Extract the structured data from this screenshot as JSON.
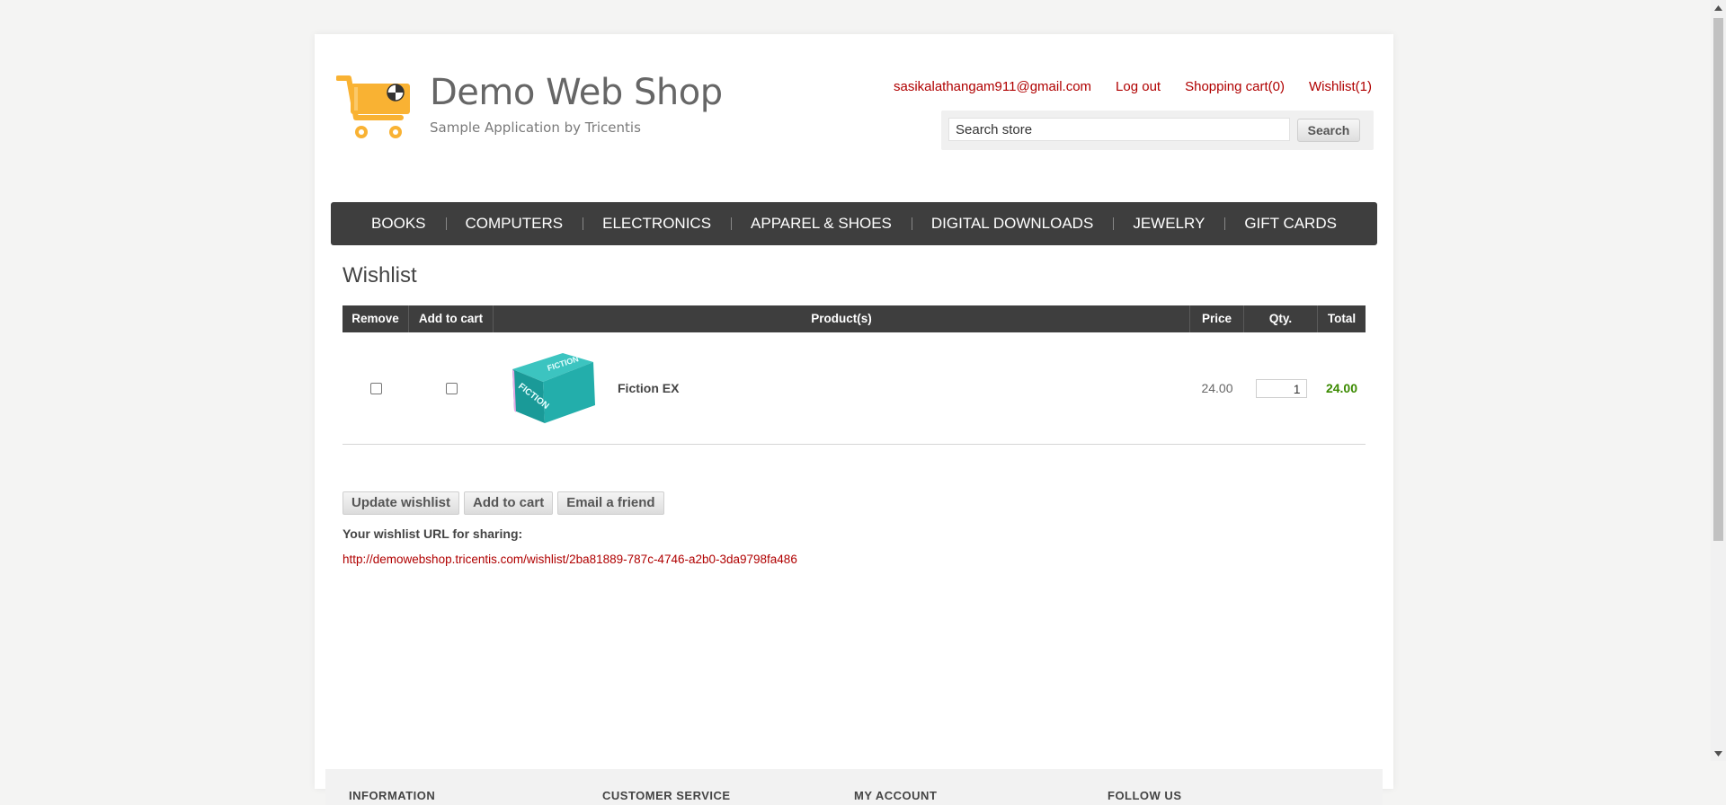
{
  "header": {
    "logo_title": "Demo Web Shop",
    "logo_subtitle": "Sample Application by Tricentis",
    "links": {
      "account": "sasikalathangam911@gmail.com",
      "logout": "Log out",
      "cart": "Shopping cart(0)",
      "wishlist": "Wishlist(1)"
    },
    "search": {
      "value": "Search store",
      "button": "Search"
    }
  },
  "nav": {
    "items": [
      "BOOKS",
      "COMPUTERS",
      "ELECTRONICS",
      "APPAREL & SHOES",
      "DIGITAL DOWNLOADS",
      "JEWELRY",
      "GIFT CARDS"
    ]
  },
  "main": {
    "title": "Wishlist",
    "table": {
      "headers": [
        "Remove",
        "Add to cart",
        "Product(s)",
        "Price",
        "Qty.",
        "Total"
      ],
      "rows": [
        {
          "product": "Fiction EX",
          "image_text": "FICTION",
          "price": "24.00",
          "qty": "1",
          "total": "24.00"
        }
      ]
    },
    "buttons": {
      "update": "Update wishlist",
      "add_to_cart": "Add to cart",
      "email": "Email a friend"
    },
    "share_label": "Your wishlist URL for sharing:",
    "share_url": "http://demowebshop.tricentis.com/wishlist/2ba81889-787c-4746-a2b0-3da9798fa486"
  },
  "footer": {
    "columns": [
      "INFORMATION",
      "CUSTOMER SERVICE",
      "MY ACCOUNT",
      "FOLLOW US"
    ]
  },
  "colors": {
    "accent_link": "#b00000",
    "nav_bg": "#3e3e3e",
    "total_green": "#3b8a00",
    "logo_orange": "#f9b233"
  }
}
